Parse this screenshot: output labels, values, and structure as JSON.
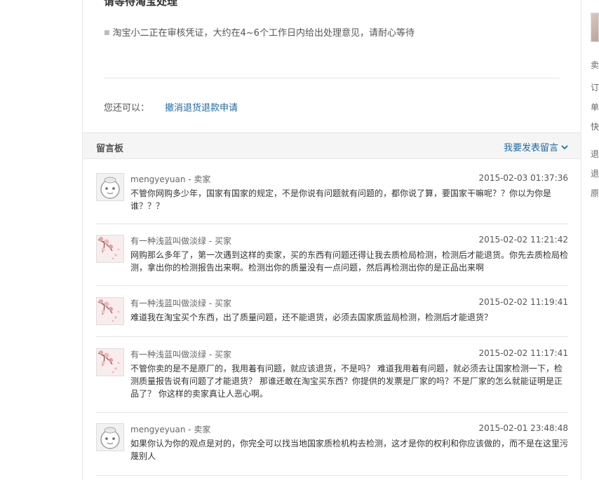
{
  "detail": {
    "cut_title": "请等待淘宝处理",
    "note": "淘宝小二正在审核凭证，大约在4~6个工作日内给出处理意见，请耐心等待",
    "also_label": "您还可以：",
    "cancel_link": "撤消退货退款申请"
  },
  "board": {
    "title": "留言板",
    "post_label": "我要发表留言",
    "messages": [
      {
        "author": "mengyeyuan - 卖家",
        "time": "2015-02-03 01:37:36",
        "avatar": "mascot",
        "content": "不管你网购多少年，国家有国家的规定，不是你说有问题就有问题的，都你说了算，要国家干嘛呢？？你以为你是谁？？？"
      },
      {
        "author": "有一种浅蓝叫做淡绿 - 买家",
        "time": "2015-02-02 11:21:42",
        "avatar": "blossom",
        "content": "网购那么多年了，第一次遇到这样的卖家，买的东西有问题还得让我去质检局检测，检测后才能退货。你先去质检局检测，拿出你的检测报告出来啊。检测出你的质量没有一点问题，然后再检测出你的是正品出来啊"
      },
      {
        "author": "有一种浅蓝叫做淡绿 - 买家",
        "time": "2015-02-02 11:19:41",
        "avatar": "blossom",
        "content": "难道我在淘宝买个东西，出了质量问题，还不能退货，必须去国家质监局检测，检测后才能退货？"
      },
      {
        "author": "有一种浅蓝叫做淡绿 - 买家",
        "time": "2015-02-02 11:17:41",
        "avatar": "blossom",
        "content": "不管你卖的是不是原厂的，我用着有问题，就应该退货，不是吗？ 难道我用着有问题，就必须去让国家检测一下，检测质量报告说有问题了才能退货？ 那谁还敢在淘宝买东西？你提供的发票是厂家的吗？不是厂家的怎么就能证明是正品了？ 你这样的卖家真让人恶心啊。"
      },
      {
        "author": "mengyeyuan - 卖家",
        "time": "2015-02-01 23:48:48",
        "avatar": "mascot",
        "content": "如果你认为你的观点是对的，你完全可以找当地国家质检机构去检测，这才是你的权利和你应该做的，而不是在这里污蔑别人"
      }
    ]
  },
  "side": {
    "items": [
      "卖",
      "订",
      "单",
      "快",
      "退",
      "退",
      "原"
    ]
  }
}
